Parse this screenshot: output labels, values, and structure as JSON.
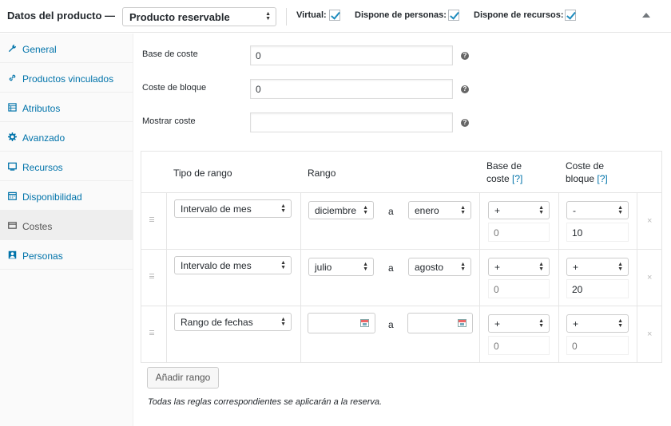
{
  "header": {
    "title": "Datos del producto —",
    "product_type": "Producto reservable",
    "options": [
      {
        "label": "Virtual:",
        "checked": true
      },
      {
        "label": "Dispone de personas:",
        "checked": true
      },
      {
        "label": "Dispone de recursos:",
        "checked": true
      }
    ]
  },
  "sidebar": {
    "items": [
      {
        "label": "General",
        "icon": "wrench-icon",
        "active": false
      },
      {
        "label": "Productos vinculados",
        "icon": "link-icon",
        "active": false
      },
      {
        "label": "Atributos",
        "icon": "list-icon",
        "active": false
      },
      {
        "label": "Avanzado",
        "icon": "gear-icon",
        "active": false
      },
      {
        "label": "Recursos",
        "icon": "monitor-icon",
        "active": false
      },
      {
        "label": "Disponibilidad",
        "icon": "calendar-icon",
        "active": false
      },
      {
        "label": "Costes",
        "icon": "card-icon",
        "active": true
      },
      {
        "label": "Personas",
        "icon": "person-icon",
        "active": false
      }
    ]
  },
  "fields": [
    {
      "label": "Base de coste",
      "value": "0"
    },
    {
      "label": "Coste de bloque",
      "value": "0"
    },
    {
      "label": "Mostrar coste",
      "value": ""
    }
  ],
  "table": {
    "headers": {
      "tipo": "Tipo de rango",
      "rango": "Rango",
      "base_line1": "Base de",
      "base_line2": "coste",
      "bloque_line1": "Coste de",
      "bloque_line2": "bloque",
      "help_link": "[?]"
    },
    "separator": "a",
    "rows": [
      {
        "type": "Intervalo de mes",
        "from": "diciembre",
        "to": "enero",
        "base_op": "+",
        "base_val": "0",
        "block_op": "-",
        "block_val": "10"
      },
      {
        "type": "Intervalo de mes",
        "from": "julio",
        "to": "agosto",
        "base_op": "+",
        "base_val": "0",
        "block_op": "+",
        "block_val": "20"
      },
      {
        "type": "Rango de fechas",
        "from": "",
        "to": "",
        "base_op": "+",
        "base_val": "0",
        "block_op": "+",
        "block_val": "0"
      }
    ],
    "remove_glyph": "×"
  },
  "add_range_label": "Añadir rango",
  "note": "Todas las reglas correspondientes se aplicarán a la reserva.",
  "colors": {
    "link": "#0073aa",
    "check": "#1e8cbe"
  }
}
